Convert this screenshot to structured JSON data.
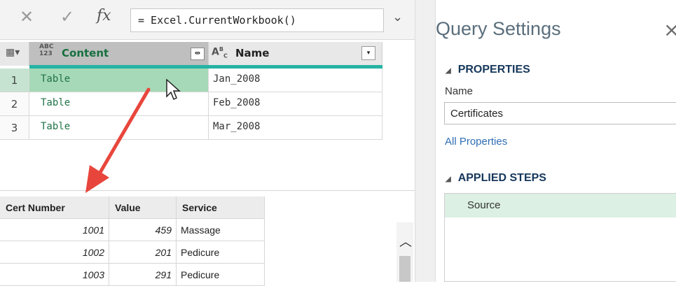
{
  "formula_bar": {
    "cancel_icon": "close-icon",
    "commit_icon": "check-icon",
    "fx_label": "fx",
    "formula": "= Excel.CurrentWorkbook()"
  },
  "grid": {
    "columns": [
      {
        "type_label": "ABC\n123",
        "name": "Content"
      },
      {
        "type_label": "ABC",
        "name": "Name"
      }
    ],
    "rows": [
      {
        "num": "1",
        "content": "Table",
        "name": "Jan_2008"
      },
      {
        "num": "2",
        "content": "Table",
        "name": "Feb_2008"
      },
      {
        "num": "3",
        "content": "Table",
        "name": "Mar_2008"
      }
    ]
  },
  "preview": {
    "headers": [
      "Cert Number",
      "Value",
      "Service"
    ],
    "rows": [
      [
        "1001",
        "459",
        "Massage"
      ],
      [
        "1002",
        "201",
        "Pedicure"
      ],
      [
        "1003",
        "291",
        "Pedicure"
      ]
    ]
  },
  "query_settings": {
    "title": "Query Settings",
    "properties_header": "PROPERTIES",
    "name_label": "Name",
    "name_value": "Certificates",
    "all_properties_link": "All Properties",
    "applied_steps_header": "APPLIED STEPS",
    "steps": [
      "Source"
    ]
  },
  "colors": {
    "accent": "#25b3a4",
    "selected_cell": "#a6d9b8",
    "table_text": "#217346",
    "arrow": "#e8463c"
  }
}
